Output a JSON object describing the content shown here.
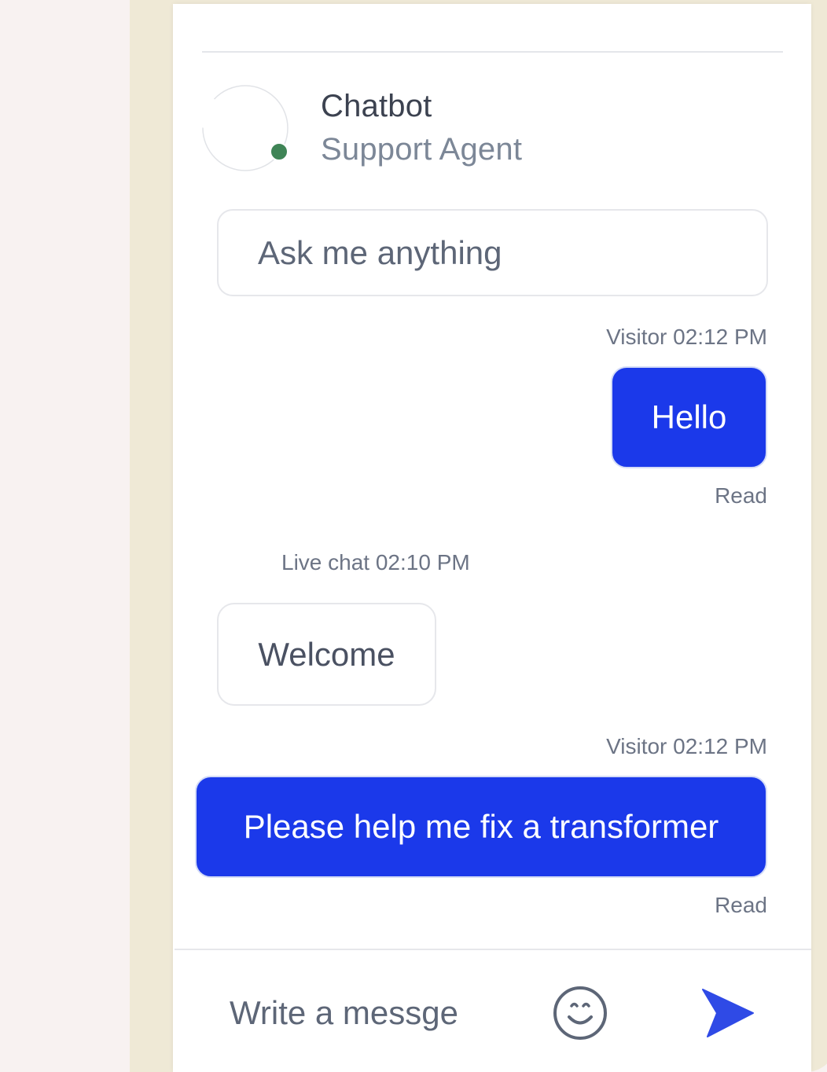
{
  "header": {
    "name": "Chatbot",
    "role": "Support Agent",
    "status_color": "#3f8456"
  },
  "intro": {
    "text": "Ask me anything"
  },
  "messages": [
    {
      "sender": "visitor",
      "meta": "Visitor 02:12 PM",
      "text": "Hello",
      "receipt": "Read"
    },
    {
      "sender": "agent",
      "meta": "Live chat 02:10 PM",
      "text": "Welcome"
    },
    {
      "sender": "visitor",
      "meta": "Visitor 02:12 PM",
      "text": "Please help me fix a transformer",
      "receipt": "Read"
    }
  ],
  "composer": {
    "placeholder": "Write a messge",
    "emoji_icon": "smiley-face-icon",
    "send_icon": "send-arrow-icon"
  },
  "colors": {
    "accent": "#1b39ea",
    "text_primary": "#3c4250",
    "text_muted": "#7c8797"
  }
}
